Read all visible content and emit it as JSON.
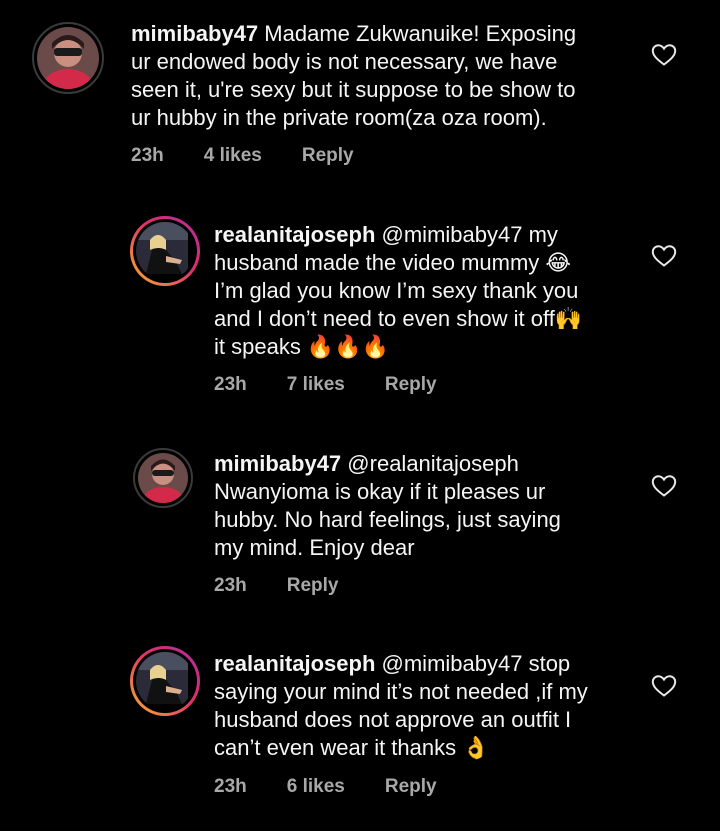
{
  "comments": [
    {
      "username": "mimibaby47",
      "mention": "",
      "text": " Madame Zukwanuike! Exposing ur endowed body is not necessary, we have seen it, u're sexy but it suppose to be show to ur hubby in the private room(za oza room).",
      "lines": [
        "Madame Zukwanuike! Exposing",
        "ur endowed body is not necessary, we have",
        "seen it, u're sexy but it suppose to be show to",
        "ur hubby in the private room(za oza room)."
      ],
      "time": "23h",
      "likes": "4 likes",
      "reply": "Reply"
    },
    {
      "username": "realanitajoseph",
      "mention": "@mimibaby47",
      "lines": [
        "my",
        "husband made the video mummy 😂",
        "I’m glad you know I’m sexy thank you",
        "and I don’t need to even show it off🙌",
        "it speaks 🔥🔥🔥"
      ],
      "time": "23h",
      "likes": "7 likes",
      "reply": "Reply"
    },
    {
      "username": "mimibaby47",
      "mention": "@realanitajoseph",
      "lines": [
        "",
        "Nwanyioma is okay if it pleases ur",
        "hubby. No hard feelings, just saying",
        "my mind. Enjoy dear"
      ],
      "time": "23h",
      "likes": "",
      "reply": "Reply"
    },
    {
      "username": "realanitajoseph",
      "mention": "@mimibaby47",
      "lines": [
        "stop",
        "saying your mind it’s not needed ,if my",
        "husband does not approve an outfit I",
        "can’t even wear it thanks 👌"
      ],
      "time": "23h",
      "likes": "6 likes",
      "reply": "Reply"
    }
  ],
  "icons": {
    "like": "heart-outline-icon"
  },
  "colors": {
    "background": "#000000",
    "text": "#f5f5f5",
    "meta": "#a8a8a8"
  }
}
